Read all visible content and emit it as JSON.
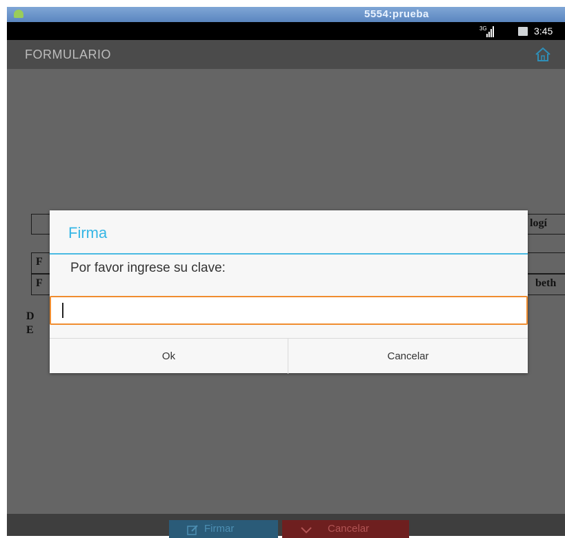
{
  "emulator": {
    "title": "5554:prueba"
  },
  "status_bar": {
    "network": "3G",
    "time": "3:45"
  },
  "action_bar": {
    "title": "FORMULARIO",
    "home_icon": "home-icon",
    "accent": "#35b6e5"
  },
  "background_form": {
    "fragments": [
      "logí",
      "F",
      "F",
      "beth",
      "D",
      "E"
    ]
  },
  "dialog": {
    "title": "Firma",
    "message": "Por favor ingrese su clave:",
    "input_value": "",
    "ok_label": "Ok",
    "cancel_label": "Cancelar",
    "title_color": "#35b6e5",
    "input_focus_color": "#f08c2e"
  },
  "bottom_bar": {
    "firmar_label": "Firmar",
    "cancelar_label": "Cancelar",
    "firmar_icon": "edit-icon",
    "cancelar_icon": "check-icon"
  }
}
